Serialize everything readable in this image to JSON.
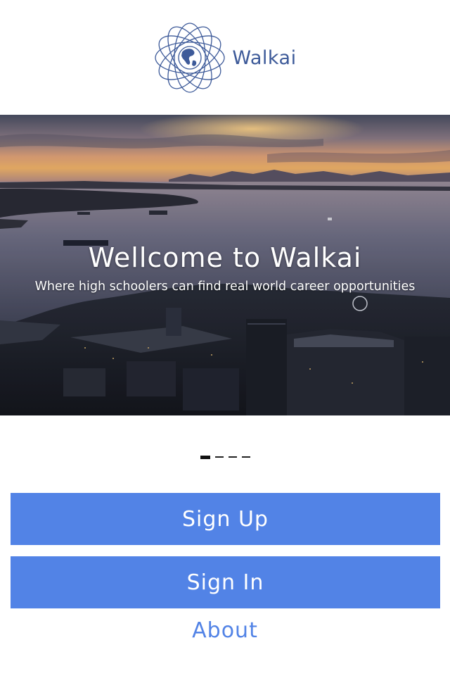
{
  "header": {
    "logo_icon": "globe-orbit-icon",
    "logo_text": "Walkai",
    "brand_color": "#3d5a99"
  },
  "hero": {
    "title": "Wellcome to Walkai",
    "subtitle": "Where high schoolers can find real world career opportunities",
    "image": "sunset-city-harbor-aerial"
  },
  "pager": {
    "count": 4,
    "active_index": 0
  },
  "actions": {
    "signup_label": "Sign Up",
    "signin_label": "Sign In",
    "about_label": "About",
    "accent_color": "#5283e6"
  }
}
